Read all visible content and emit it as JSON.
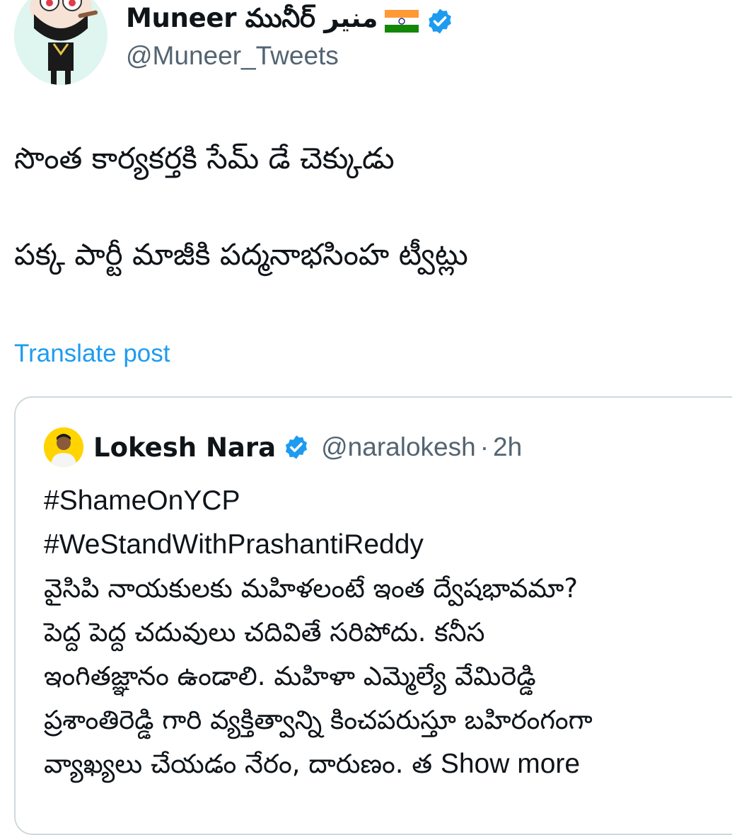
{
  "tweet": {
    "author": {
      "display_name": "Muneer మునీర్ منیر",
      "flag": "🇮🇳",
      "verified_icon": "verified-badge-icon",
      "handle": "@Muneer_Tweets"
    },
    "text_lines": [
      "సొంత కార్యకర్తకి సేమ్ డే చెక్కుడు",
      "పక్క పార్టీ మాజీకి పద్మనాభసింహ ట్వీట్లు"
    ],
    "translate_label": "Translate post"
  },
  "quoted_tweet": {
    "author": {
      "display_name": "Lokesh Nara",
      "handle": "@naralokesh",
      "dot": "·",
      "time": "2h"
    },
    "lines": [
      "#ShameOnYCP",
      "#WeStandWithPrashantiReddy",
      "వైసిపి నాయకులకు మహిళలంటే ఇంత ద్వేషభావమా?",
      "పెద్ద పెద్ద చదువులు చదివితే సరిపోదు. కనీస",
      "ఇంగితజ్ఞానం ఉండాలి. మహిళా ఎమ్మెల్యే వేమిరెడ్డి",
      "ప్రశాంతిరెడ్డి గారి వ్యక్తిత్వాన్ని కించపరుస్తూ బహిరంగంగా",
      "వ్యాఖ్యలు చేయడం నేరం, దారుణం. త"
    ],
    "show_more_label": "Show more"
  },
  "colors": {
    "link": "#1d9bf0",
    "secondary_text": "#536471",
    "border": "#cfd9de",
    "verified": "#1d9bf0"
  }
}
